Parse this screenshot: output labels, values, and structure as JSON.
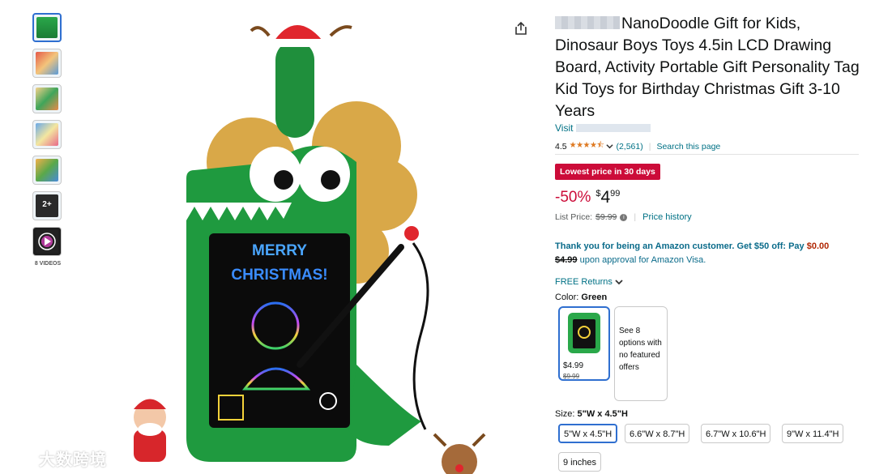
{
  "thumbnails": {
    "count": 7,
    "videos_label": "8 VIDEOS"
  },
  "main_image": {
    "headline_1": "MERRY",
    "headline_2": "CHRISTMAS!"
  },
  "product": {
    "title": "NanoDoodle Gift for Kids, Dinosaur Boys Toys 4.5in LCD Drawing Board, Activity Portable Gift Personality Tag Kid Toys for Birthday Christmas Gift 3-10 Years",
    "visit_label": "Visit",
    "rating_value": "4.5",
    "stars": "★★★★⯪",
    "rating_count": "(2,561)",
    "search_page": "Search this page"
  },
  "deal": {
    "badge": "Lowest price in 30 days",
    "discount": "-50%",
    "currency": "$",
    "whole": "4",
    "fraction": "99",
    "list_price_label": "List Price:",
    "list_price": "$9.99",
    "price_history": "Price history"
  },
  "offer": {
    "part1": "Thank you for being an Amazon customer. Get $50 off: Pay",
    "pay_amount": "$0.00",
    "struck": "$4.99",
    "part2": "upon approval for Amazon Visa."
  },
  "returns": {
    "label": "FREE Returns"
  },
  "color": {
    "label": "Color:",
    "selected": "Green",
    "option_price": "$4.99",
    "option_old_price": "$9.99",
    "more_options": "See 8 options with no featured offers"
  },
  "size": {
    "label": "Size:",
    "selected": "5\"W x 4.5\"H",
    "options": [
      "5\"W x 4.5\"H",
      "6.6\"W x 8.7\"H",
      "6.7\"W x 10.6\"H",
      "9\"W x 11.4\"H",
      "9 inches"
    ]
  },
  "watermark": {
    "text": "大数跨境"
  },
  "colors": {
    "link": "#007185",
    "deal_red": "#cc0c39",
    "star": "#de7921",
    "selected_border": "#2f6fd0",
    "dino_green": "#1f9a3f"
  }
}
